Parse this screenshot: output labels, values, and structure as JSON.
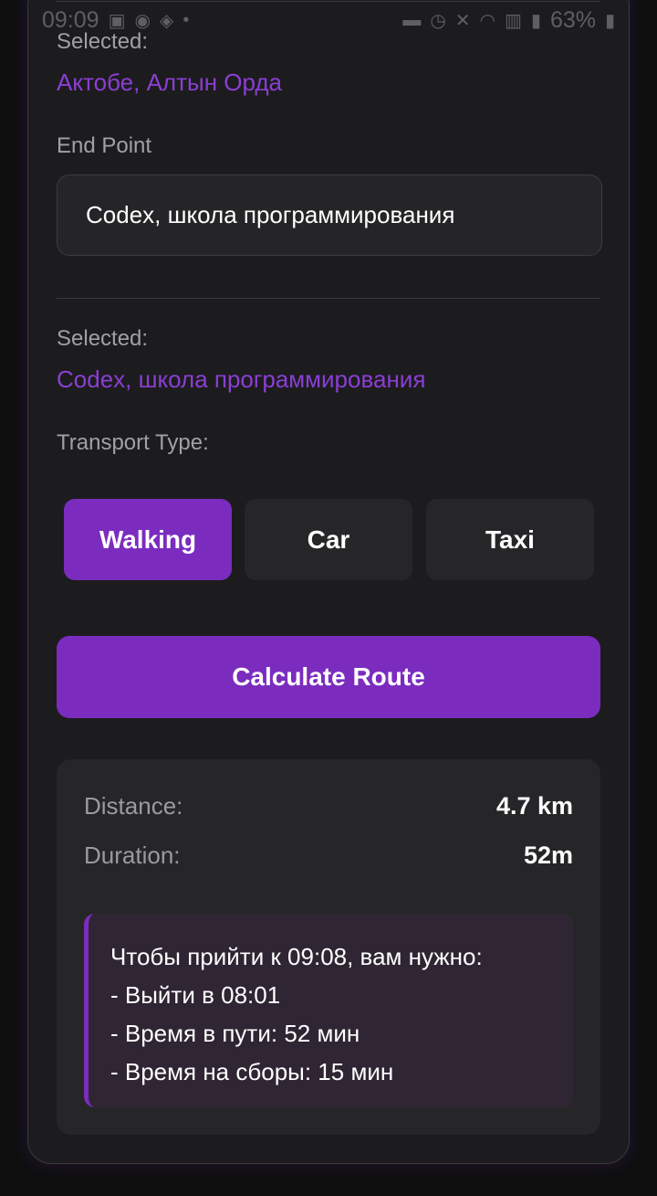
{
  "status_bar": {
    "time": "09:09",
    "battery": "63%"
  },
  "start": {
    "selected_label": "Selected:",
    "selected_value": "Актобе, Алтын Орда"
  },
  "end": {
    "label": "End Point",
    "input_value": "Codex, школа программирования",
    "selected_label": "Selected:",
    "selected_value": "Codex, школа программирования"
  },
  "transport": {
    "label": "Transport Type:",
    "options": [
      "Walking",
      "Car",
      "Taxi"
    ],
    "selected": "Walking"
  },
  "calculate_label": "Calculate Route",
  "result": {
    "distance_label": "Distance:",
    "distance_value": "4.7 km",
    "duration_label": "Duration:",
    "duration_value": "52m",
    "note_lines": [
      "Чтобы прийти к 09:08, вам нужно:",
      "- Выйти в 08:01",
      "- Время в пути: 52 мин",
      "- Время на сборы: 15 мин"
    ]
  },
  "colors": {
    "accent": "#7b2cbf",
    "accent_text": "#8b3ed4",
    "background": "#0f0f10",
    "card": "#1c1c1e"
  }
}
